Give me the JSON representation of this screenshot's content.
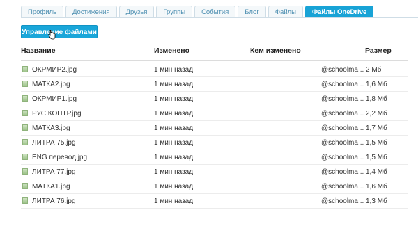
{
  "tabs": [
    {
      "label": "Профиль",
      "active": false
    },
    {
      "label": "Достижения",
      "active": false
    },
    {
      "label": "Друзья",
      "active": false
    },
    {
      "label": "Группы",
      "active": false
    },
    {
      "label": "События",
      "active": false
    },
    {
      "label": "Блог",
      "active": false
    },
    {
      "label": "Файлы",
      "active": false
    },
    {
      "label": "Файлы OneDrive",
      "active": true
    }
  ],
  "toolbar": {
    "manage_label": "Управление файлами"
  },
  "table": {
    "columns": {
      "name": "Название",
      "modified": "Изменено",
      "modified_by": "Кем изменено",
      "size": "Размер"
    },
    "rows": [
      {
        "name": "ОКРМИР2.jpg",
        "modified": "1 мин назад",
        "modified_by": "@schoolma...",
        "size": "2 Мб"
      },
      {
        "name": "МАТКА2.jpg",
        "modified": "1 мин назад",
        "modified_by": "@schoolma...",
        "size": "1,6 Мб"
      },
      {
        "name": "ОКРМИР1.jpg",
        "modified": "1 мин назад",
        "modified_by": "@schoolma...",
        "size": "1,8 Мб"
      },
      {
        "name": "РУС КОНТР.jpg",
        "modified": "1 мин назад",
        "modified_by": "@schoolma...",
        "size": "2,2 Мб"
      },
      {
        "name": "МАТКА3.jpg",
        "modified": "1 мин назад",
        "modified_by": "@schoolma...",
        "size": "1,7 Мб"
      },
      {
        "name": "ЛИТРА 75.jpg",
        "modified": "1 мин назад",
        "modified_by": "@schoolma...",
        "size": "1,5 Мб"
      },
      {
        "name": "ENG перевод.jpg",
        "modified": "1 мин назад",
        "modified_by": "@schoolma...",
        "size": "1,5 Мб"
      },
      {
        "name": "ЛИТРА 77.jpg",
        "modified": "1 мин назад",
        "modified_by": "@schoolma...",
        "size": "1,4 Мб"
      },
      {
        "name": "МАТКА1.jpg",
        "modified": "1 мин назад",
        "modified_by": "@schoolma...",
        "size": "1,6 Мб"
      },
      {
        "name": "ЛИТРА 76.jpg",
        "modified": "1 мин назад",
        "modified_by": "@schoolma...",
        "size": "1,3 Мб"
      }
    ]
  },
  "icons": {
    "file": "image-file-icon",
    "cursor": "hand-cursor-icon"
  }
}
